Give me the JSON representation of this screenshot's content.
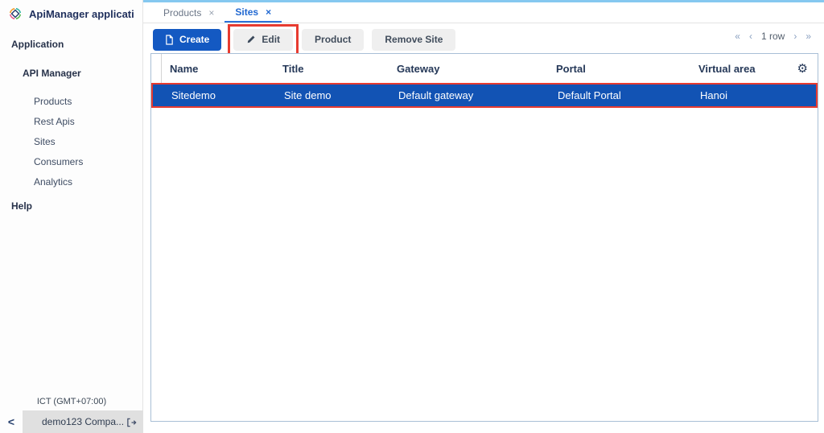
{
  "app": {
    "title": "ApiManager applicati..."
  },
  "sidebar": {
    "section_application": "Application",
    "group_api_manager": "API Manager",
    "items": [
      {
        "label": "Products"
      },
      {
        "label": "Rest Apis"
      },
      {
        "label": "Sites"
      },
      {
        "label": "Consumers"
      },
      {
        "label": "Analytics"
      }
    ],
    "section_help": "Help",
    "timezone": "ICT (GMT+07:00)",
    "company": "demo123 Compa...",
    "collapse": "<"
  },
  "tabs": [
    {
      "label": "Products",
      "close": "×"
    },
    {
      "label": "Sites",
      "close": "×"
    }
  ],
  "toolbar": {
    "create_label": "Create",
    "edit_label": "Edit",
    "product_label": "Product",
    "remove_site_label": "Remove Site"
  },
  "pagination": {
    "first": "«",
    "prev": "‹",
    "status": "1 row",
    "next": "›",
    "last": "»"
  },
  "table": {
    "columns": [
      "Name",
      "Title",
      "Gateway",
      "Portal",
      "Virtual area"
    ],
    "rows": [
      {
        "name": "Sitedemo",
        "title": "Site demo",
        "gateway": "Default gateway",
        "portal": "Default Portal",
        "virtual_area": "Hanoi",
        "selected": true
      }
    ]
  },
  "icons": {
    "gear": "⚙"
  },
  "colors": {
    "accent_blue": "#1459c2",
    "selected_row_blue": "#1253b4",
    "annotation_red": "#e73b30",
    "tab_active_blue": "#2168d1",
    "top_accent_blue": "#85c8f0"
  }
}
